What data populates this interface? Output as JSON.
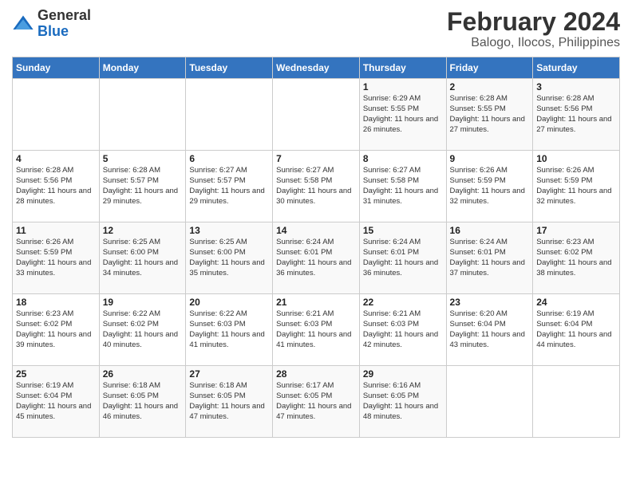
{
  "logo": {
    "text_general": "General",
    "text_blue": "Blue"
  },
  "title": "February 2024",
  "subtitle": "Balogo, Ilocos, Philippines",
  "headers": [
    "Sunday",
    "Monday",
    "Tuesday",
    "Wednesday",
    "Thursday",
    "Friday",
    "Saturday"
  ],
  "weeks": [
    [
      {
        "day": "",
        "sunrise": "",
        "sunset": "",
        "daylight": ""
      },
      {
        "day": "",
        "sunrise": "",
        "sunset": "",
        "daylight": ""
      },
      {
        "day": "",
        "sunrise": "",
        "sunset": "",
        "daylight": ""
      },
      {
        "day": "",
        "sunrise": "",
        "sunset": "",
        "daylight": ""
      },
      {
        "day": "1",
        "sunrise": "Sunrise: 6:29 AM",
        "sunset": "Sunset: 5:55 PM",
        "daylight": "Daylight: 11 hours and 26 minutes."
      },
      {
        "day": "2",
        "sunrise": "Sunrise: 6:28 AM",
        "sunset": "Sunset: 5:55 PM",
        "daylight": "Daylight: 11 hours and 27 minutes."
      },
      {
        "day": "3",
        "sunrise": "Sunrise: 6:28 AM",
        "sunset": "Sunset: 5:56 PM",
        "daylight": "Daylight: 11 hours and 27 minutes."
      }
    ],
    [
      {
        "day": "4",
        "sunrise": "Sunrise: 6:28 AM",
        "sunset": "Sunset: 5:56 PM",
        "daylight": "Daylight: 11 hours and 28 minutes."
      },
      {
        "day": "5",
        "sunrise": "Sunrise: 6:28 AM",
        "sunset": "Sunset: 5:57 PM",
        "daylight": "Daylight: 11 hours and 29 minutes."
      },
      {
        "day": "6",
        "sunrise": "Sunrise: 6:27 AM",
        "sunset": "Sunset: 5:57 PM",
        "daylight": "Daylight: 11 hours and 29 minutes."
      },
      {
        "day": "7",
        "sunrise": "Sunrise: 6:27 AM",
        "sunset": "Sunset: 5:58 PM",
        "daylight": "Daylight: 11 hours and 30 minutes."
      },
      {
        "day": "8",
        "sunrise": "Sunrise: 6:27 AM",
        "sunset": "Sunset: 5:58 PM",
        "daylight": "Daylight: 11 hours and 31 minutes."
      },
      {
        "day": "9",
        "sunrise": "Sunrise: 6:26 AM",
        "sunset": "Sunset: 5:59 PM",
        "daylight": "Daylight: 11 hours and 32 minutes."
      },
      {
        "day": "10",
        "sunrise": "Sunrise: 6:26 AM",
        "sunset": "Sunset: 5:59 PM",
        "daylight": "Daylight: 11 hours and 32 minutes."
      }
    ],
    [
      {
        "day": "11",
        "sunrise": "Sunrise: 6:26 AM",
        "sunset": "Sunset: 5:59 PM",
        "daylight": "Daylight: 11 hours and 33 minutes."
      },
      {
        "day": "12",
        "sunrise": "Sunrise: 6:25 AM",
        "sunset": "Sunset: 6:00 PM",
        "daylight": "Daylight: 11 hours and 34 minutes."
      },
      {
        "day": "13",
        "sunrise": "Sunrise: 6:25 AM",
        "sunset": "Sunset: 6:00 PM",
        "daylight": "Daylight: 11 hours and 35 minutes."
      },
      {
        "day": "14",
        "sunrise": "Sunrise: 6:24 AM",
        "sunset": "Sunset: 6:01 PM",
        "daylight": "Daylight: 11 hours and 36 minutes."
      },
      {
        "day": "15",
        "sunrise": "Sunrise: 6:24 AM",
        "sunset": "Sunset: 6:01 PM",
        "daylight": "Daylight: 11 hours and 36 minutes."
      },
      {
        "day": "16",
        "sunrise": "Sunrise: 6:24 AM",
        "sunset": "Sunset: 6:01 PM",
        "daylight": "Daylight: 11 hours and 37 minutes."
      },
      {
        "day": "17",
        "sunrise": "Sunrise: 6:23 AM",
        "sunset": "Sunset: 6:02 PM",
        "daylight": "Daylight: 11 hours and 38 minutes."
      }
    ],
    [
      {
        "day": "18",
        "sunrise": "Sunrise: 6:23 AM",
        "sunset": "Sunset: 6:02 PM",
        "daylight": "Daylight: 11 hours and 39 minutes."
      },
      {
        "day": "19",
        "sunrise": "Sunrise: 6:22 AM",
        "sunset": "Sunset: 6:02 PM",
        "daylight": "Daylight: 11 hours and 40 minutes."
      },
      {
        "day": "20",
        "sunrise": "Sunrise: 6:22 AM",
        "sunset": "Sunset: 6:03 PM",
        "daylight": "Daylight: 11 hours and 41 minutes."
      },
      {
        "day": "21",
        "sunrise": "Sunrise: 6:21 AM",
        "sunset": "Sunset: 6:03 PM",
        "daylight": "Daylight: 11 hours and 41 minutes."
      },
      {
        "day": "22",
        "sunrise": "Sunrise: 6:21 AM",
        "sunset": "Sunset: 6:03 PM",
        "daylight": "Daylight: 11 hours and 42 minutes."
      },
      {
        "day": "23",
        "sunrise": "Sunrise: 6:20 AM",
        "sunset": "Sunset: 6:04 PM",
        "daylight": "Daylight: 11 hours and 43 minutes."
      },
      {
        "day": "24",
        "sunrise": "Sunrise: 6:19 AM",
        "sunset": "Sunset: 6:04 PM",
        "daylight": "Daylight: 11 hours and 44 minutes."
      }
    ],
    [
      {
        "day": "25",
        "sunrise": "Sunrise: 6:19 AM",
        "sunset": "Sunset: 6:04 PM",
        "daylight": "Daylight: 11 hours and 45 minutes."
      },
      {
        "day": "26",
        "sunrise": "Sunrise: 6:18 AM",
        "sunset": "Sunset: 6:05 PM",
        "daylight": "Daylight: 11 hours and 46 minutes."
      },
      {
        "day": "27",
        "sunrise": "Sunrise: 6:18 AM",
        "sunset": "Sunset: 6:05 PM",
        "daylight": "Daylight: 11 hours and 47 minutes."
      },
      {
        "day": "28",
        "sunrise": "Sunrise: 6:17 AM",
        "sunset": "Sunset: 6:05 PM",
        "daylight": "Daylight: 11 hours and 47 minutes."
      },
      {
        "day": "29",
        "sunrise": "Sunrise: 6:16 AM",
        "sunset": "Sunset: 6:05 PM",
        "daylight": "Daylight: 11 hours and 48 minutes."
      },
      {
        "day": "",
        "sunrise": "",
        "sunset": "",
        "daylight": ""
      },
      {
        "day": "",
        "sunrise": "",
        "sunset": "",
        "daylight": ""
      }
    ]
  ]
}
